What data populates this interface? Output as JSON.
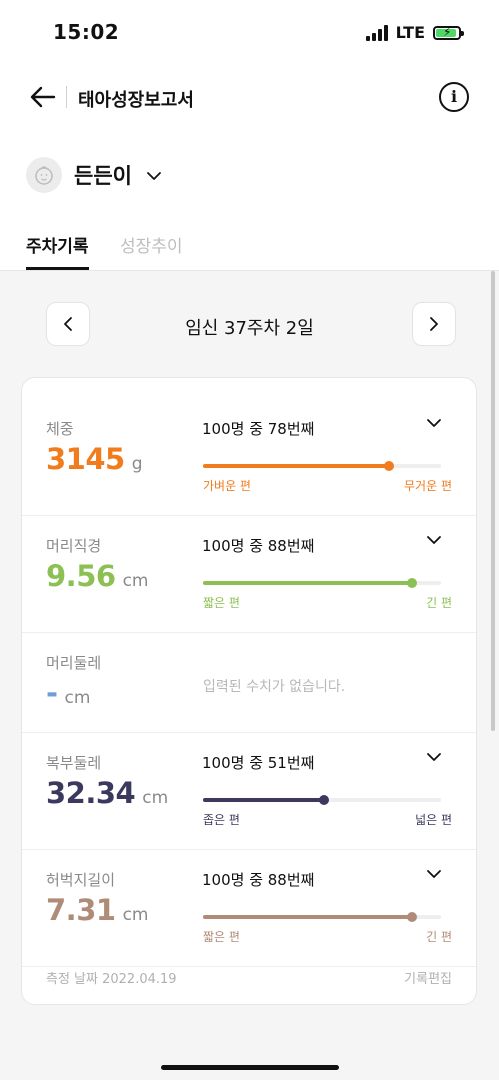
{
  "status_bar": {
    "time": "15:02",
    "network": "LTE"
  },
  "header": {
    "title": "태아성장보고서"
  },
  "profile": {
    "name": "든든이"
  },
  "tabs": [
    {
      "label": "주차기록",
      "active": true
    },
    {
      "label": "성장추이",
      "active": false
    }
  ],
  "week_nav": {
    "label": "임신 37주차 2일"
  },
  "measurements": [
    {
      "label": "체중",
      "value": "3145",
      "unit": "g",
      "rank": "100명 중 78번째",
      "percent": 78,
      "color": "#f07c1e",
      "low_label": "가벼운 편",
      "high_label": "무거운 편"
    },
    {
      "label": "머리직경",
      "value": "9.56",
      "unit": "cm",
      "rank": "100명 중 88번째",
      "percent": 88,
      "color": "#8dc054",
      "low_label": "짧은 편",
      "high_label": "긴 편"
    },
    {
      "label": "머리둘레",
      "value": "-",
      "unit": "cm",
      "empty_text": "입력된 수치가 없습니다.",
      "color": "#6f9fd6"
    },
    {
      "label": "복부둘레",
      "value": "32.34",
      "unit": "cm",
      "rank": "100명 중 51번째",
      "percent": 51,
      "color": "#3b3a5e",
      "low_label": "좁은 편",
      "high_label": "넓은 편"
    },
    {
      "label": "허벅지길이",
      "value": "7.31",
      "unit": "cm",
      "rank": "100명 중 88번째",
      "percent": 88,
      "color": "#b08c78",
      "low_label": "짧은 편",
      "high_label": "긴 편"
    }
  ],
  "footer": {
    "date": "측정 날짜 2022.04.19",
    "edit": "기록편집"
  }
}
